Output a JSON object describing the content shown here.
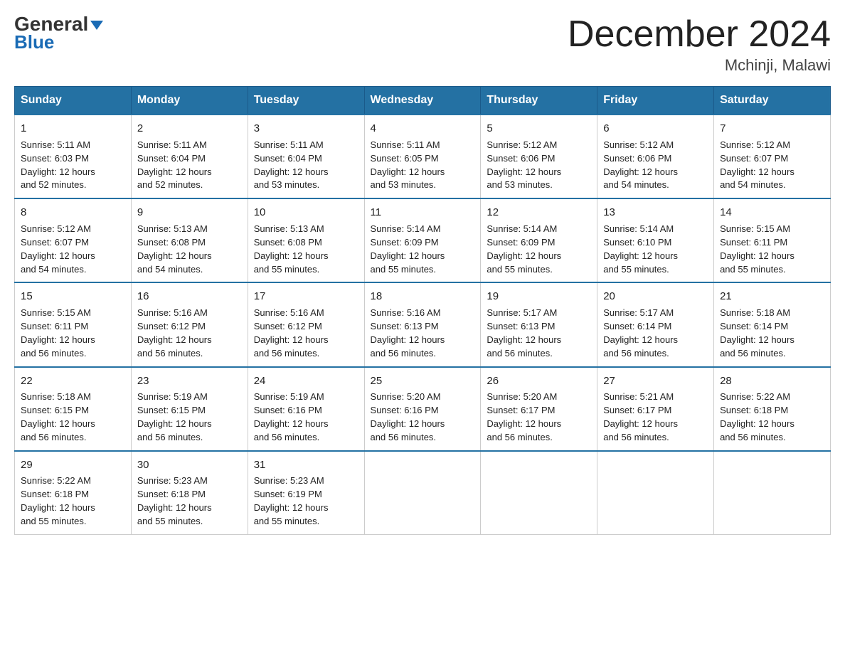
{
  "header": {
    "logo_line1": "General",
    "logo_line2": "Blue",
    "month_title": "December 2024",
    "location": "Mchinji, Malawi"
  },
  "days_of_week": [
    "Sunday",
    "Monday",
    "Tuesday",
    "Wednesday",
    "Thursday",
    "Friday",
    "Saturday"
  ],
  "weeks": [
    [
      {
        "day": "1",
        "sunrise": "5:11 AM",
        "sunset": "6:03 PM",
        "daylight": "12 hours and 52 minutes."
      },
      {
        "day": "2",
        "sunrise": "5:11 AM",
        "sunset": "6:04 PM",
        "daylight": "12 hours and 52 minutes."
      },
      {
        "day": "3",
        "sunrise": "5:11 AM",
        "sunset": "6:04 PM",
        "daylight": "12 hours and 53 minutes."
      },
      {
        "day": "4",
        "sunrise": "5:11 AM",
        "sunset": "6:05 PM",
        "daylight": "12 hours and 53 minutes."
      },
      {
        "day": "5",
        "sunrise": "5:12 AM",
        "sunset": "6:06 PM",
        "daylight": "12 hours and 53 minutes."
      },
      {
        "day": "6",
        "sunrise": "5:12 AM",
        "sunset": "6:06 PM",
        "daylight": "12 hours and 54 minutes."
      },
      {
        "day": "7",
        "sunrise": "5:12 AM",
        "sunset": "6:07 PM",
        "daylight": "12 hours and 54 minutes."
      }
    ],
    [
      {
        "day": "8",
        "sunrise": "5:12 AM",
        "sunset": "6:07 PM",
        "daylight": "12 hours and 54 minutes."
      },
      {
        "day": "9",
        "sunrise": "5:13 AM",
        "sunset": "6:08 PM",
        "daylight": "12 hours and 54 minutes."
      },
      {
        "day": "10",
        "sunrise": "5:13 AM",
        "sunset": "6:08 PM",
        "daylight": "12 hours and 55 minutes."
      },
      {
        "day": "11",
        "sunrise": "5:14 AM",
        "sunset": "6:09 PM",
        "daylight": "12 hours and 55 minutes."
      },
      {
        "day": "12",
        "sunrise": "5:14 AM",
        "sunset": "6:09 PM",
        "daylight": "12 hours and 55 minutes."
      },
      {
        "day": "13",
        "sunrise": "5:14 AM",
        "sunset": "6:10 PM",
        "daylight": "12 hours and 55 minutes."
      },
      {
        "day": "14",
        "sunrise": "5:15 AM",
        "sunset": "6:11 PM",
        "daylight": "12 hours and 55 minutes."
      }
    ],
    [
      {
        "day": "15",
        "sunrise": "5:15 AM",
        "sunset": "6:11 PM",
        "daylight": "12 hours and 56 minutes."
      },
      {
        "day": "16",
        "sunrise": "5:16 AM",
        "sunset": "6:12 PM",
        "daylight": "12 hours and 56 minutes."
      },
      {
        "day": "17",
        "sunrise": "5:16 AM",
        "sunset": "6:12 PM",
        "daylight": "12 hours and 56 minutes."
      },
      {
        "day": "18",
        "sunrise": "5:16 AM",
        "sunset": "6:13 PM",
        "daylight": "12 hours and 56 minutes."
      },
      {
        "day": "19",
        "sunrise": "5:17 AM",
        "sunset": "6:13 PM",
        "daylight": "12 hours and 56 minutes."
      },
      {
        "day": "20",
        "sunrise": "5:17 AM",
        "sunset": "6:14 PM",
        "daylight": "12 hours and 56 minutes."
      },
      {
        "day": "21",
        "sunrise": "5:18 AM",
        "sunset": "6:14 PM",
        "daylight": "12 hours and 56 minutes."
      }
    ],
    [
      {
        "day": "22",
        "sunrise": "5:18 AM",
        "sunset": "6:15 PM",
        "daylight": "12 hours and 56 minutes."
      },
      {
        "day": "23",
        "sunrise": "5:19 AM",
        "sunset": "6:15 PM",
        "daylight": "12 hours and 56 minutes."
      },
      {
        "day": "24",
        "sunrise": "5:19 AM",
        "sunset": "6:16 PM",
        "daylight": "12 hours and 56 minutes."
      },
      {
        "day": "25",
        "sunrise": "5:20 AM",
        "sunset": "6:16 PM",
        "daylight": "12 hours and 56 minutes."
      },
      {
        "day": "26",
        "sunrise": "5:20 AM",
        "sunset": "6:17 PM",
        "daylight": "12 hours and 56 minutes."
      },
      {
        "day": "27",
        "sunrise": "5:21 AM",
        "sunset": "6:17 PM",
        "daylight": "12 hours and 56 minutes."
      },
      {
        "day": "28",
        "sunrise": "5:22 AM",
        "sunset": "6:18 PM",
        "daylight": "12 hours and 56 minutes."
      }
    ],
    [
      {
        "day": "29",
        "sunrise": "5:22 AM",
        "sunset": "6:18 PM",
        "daylight": "12 hours and 55 minutes."
      },
      {
        "day": "30",
        "sunrise": "5:23 AM",
        "sunset": "6:18 PM",
        "daylight": "12 hours and 55 minutes."
      },
      {
        "day": "31",
        "sunrise": "5:23 AM",
        "sunset": "6:19 PM",
        "daylight": "12 hours and 55 minutes."
      },
      null,
      null,
      null,
      null
    ]
  ],
  "labels": {
    "sunrise": "Sunrise:",
    "sunset": "Sunset:",
    "daylight": "Daylight:"
  }
}
